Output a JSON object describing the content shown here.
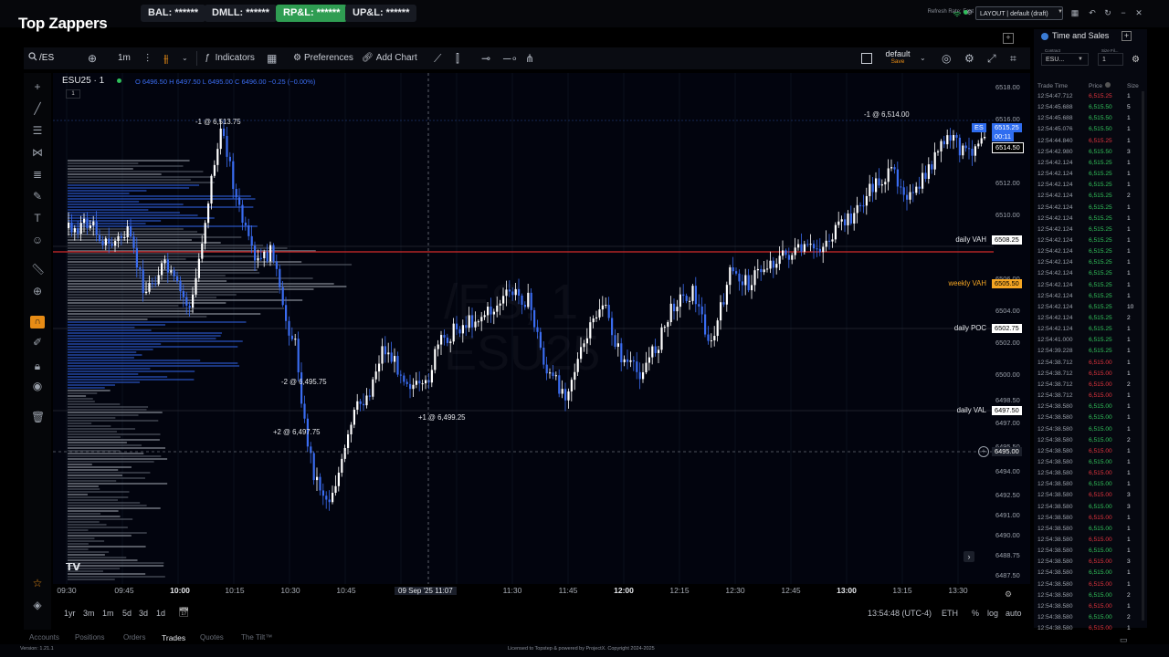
{
  "app": {
    "logo": "Top Zappers",
    "stats": [
      {
        "label": "BAL: ******",
        "style": "normal"
      },
      {
        "label": "DMLL: ******",
        "style": "normal"
      },
      {
        "label": "RP&L: ******",
        "style": "active"
      },
      {
        "label": "UP&L: ******",
        "style": "normal"
      }
    ],
    "refresh": "Refresh Rate: Fast",
    "layout": "LAYOUT | default (draft)"
  },
  "toolbar": {
    "symbol": "/ES",
    "interval": "1m",
    "indicators": "Indicators",
    "preferences": "Preferences",
    "add_chart": "Add Chart",
    "template_name": "default",
    "template_sub": "Save"
  },
  "chart": {
    "title": "ESU25 · 1",
    "sub_count": "1",
    "ohlc": "O 6496.50  H 6497.50  L 6495.00  C 6496.00  −0.25 (−0.00%)",
    "watermark_line1": "/ES, 1",
    "watermark_line2": "ESU25",
    "colors": {
      "up": "#ffffff",
      "down": "#3a6cf0",
      "resistance": "#d42a2a",
      "volume_profile": "#9aa0aa"
    },
    "price_labels": [
      "6518.00",
      "6516.00",
      "6512.00",
      "6510.00",
      "6506.00",
      "6504.00",
      "6502.00",
      "6500.00",
      "6498.50",
      "6497.00",
      "6495.50",
      "6494.00",
      "6492.50",
      "6491.00",
      "6490.00",
      "6488.75",
      "6487.50"
    ],
    "levels": [
      {
        "name": "daily VAH",
        "price": "6508.25",
        "color": "#ffffff",
        "bg": "#ffffff",
        "text": "#000000"
      },
      {
        "name": "weekly VAH",
        "price": "6505.50",
        "color": "#f5a623",
        "bg": "#f5a623",
        "text": "#000000"
      },
      {
        "name": "daily POC",
        "price": "6502.75",
        "color": "#ffffff",
        "bg": "#ffffff",
        "text": "#000000"
      },
      {
        "name": "daily VAL",
        "price": "6497.50",
        "color": "#ffffff",
        "bg": "#ffffff",
        "text": "#000000"
      }
    ],
    "current_price_label": "6514.50",
    "es_badge": "ES",
    "es_price": "6515.25",
    "es_time": "00:11",
    "crosshair_price": "6495.00",
    "trades": [
      "-1 @ 6,513.75",
      "-1 @ 6,514.00",
      "-2 @ 6,495.75",
      "+2 @ 6,497.75",
      "+1 @ 6,499.25"
    ],
    "time_labels": [
      "09:30",
      "09:45",
      "10:00",
      "10:15",
      "10:30",
      "10:45",
      "11:30",
      "11:45",
      "12:00",
      "12:15",
      "12:30",
      "12:45",
      "13:00",
      "13:15",
      "13:30"
    ],
    "crosshair_time": "09 Sep '25  11:07",
    "ranges": [
      "1yr",
      "3m",
      "1m",
      "5d",
      "3d",
      "1d"
    ],
    "clock": "13:54:48 (UTC-4)",
    "session": "ETH",
    "scale_opts": [
      "%",
      "log",
      "auto"
    ]
  },
  "tabs": [
    "Accounts",
    "Positions",
    "Orders",
    "Trades",
    "Quotes",
    "The Tilt™"
  ],
  "active_tab": "Trades",
  "footer": {
    "version": "Version: 1.21.1",
    "license": "Licensed to Topstep & powered by ProjectX. Copyright 2024-2025"
  },
  "time_and_sales": {
    "title": "Time and Sales",
    "contract_label": "Contract",
    "contract_value": "ESU...",
    "size_filter_label": "Size Fil...",
    "size_filter_value": "1",
    "headers": [
      "Trade Time",
      "Price",
      "Size"
    ],
    "rows": [
      {
        "time": "12:54:47.712",
        "price": "6,515.25",
        "size": "1",
        "side": "sell"
      },
      {
        "time": "12:54:45.688",
        "price": "6,515.50",
        "size": "5",
        "side": "buy"
      },
      {
        "time": "12:54:45.688",
        "price": "6,515.50",
        "size": "1",
        "side": "buy"
      },
      {
        "time": "12:54:45.076",
        "price": "6,515.50",
        "size": "1",
        "side": "buy"
      },
      {
        "time": "12:54:44.840",
        "price": "6,515.25",
        "size": "1",
        "side": "sell"
      },
      {
        "time": "12:54:42.980",
        "price": "6,515.50",
        "size": "3",
        "side": "buy"
      },
      {
        "time": "12:54:42.124",
        "price": "6,515.25",
        "size": "1",
        "side": "buy"
      },
      {
        "time": "12:54:42.124",
        "price": "6,515.25",
        "size": "1",
        "side": "buy"
      },
      {
        "time": "12:54:42.124",
        "price": "6,515.25",
        "size": "1",
        "side": "buy"
      },
      {
        "time": "12:54:42.124",
        "price": "6,515.25",
        "size": "2",
        "side": "buy"
      },
      {
        "time": "12:54:42.124",
        "price": "6,515.25",
        "size": "1",
        "side": "buy"
      },
      {
        "time": "12:54:42.124",
        "price": "6,515.25",
        "size": "1",
        "side": "buy"
      },
      {
        "time": "12:54:42.124",
        "price": "6,515.25",
        "size": "1",
        "side": "buy"
      },
      {
        "time": "12:54:42.124",
        "price": "6,515.25",
        "size": "1",
        "side": "buy"
      },
      {
        "time": "12:54:42.124",
        "price": "6,515.25",
        "size": "1",
        "side": "buy"
      },
      {
        "time": "12:54:42.124",
        "price": "6,515.25",
        "size": "1",
        "side": "buy"
      },
      {
        "time": "12:54:42.124",
        "price": "6,515.25",
        "size": "1",
        "side": "buy"
      },
      {
        "time": "12:54:42.124",
        "price": "6,515.25",
        "size": "1",
        "side": "buy"
      },
      {
        "time": "12:54:42.124",
        "price": "6,515.25",
        "size": "1",
        "side": "buy"
      },
      {
        "time": "12:54:42.124",
        "price": "6,515.25",
        "size": "10",
        "side": "buy"
      },
      {
        "time": "12:54:42.124",
        "price": "6,515.25",
        "size": "2",
        "side": "buy"
      },
      {
        "time": "12:54:42.124",
        "price": "6,515.25",
        "size": "1",
        "side": "buy"
      },
      {
        "time": "12:54:41.000",
        "price": "6,515.25",
        "size": "1",
        "side": "buy"
      },
      {
        "time": "12:54:39.228",
        "price": "6,515.25",
        "size": "1",
        "side": "buy"
      },
      {
        "time": "12:54:38.712",
        "price": "6,515.00",
        "size": "1",
        "side": "sell"
      },
      {
        "time": "12:54:38.712",
        "price": "6,515.00",
        "size": "1",
        "side": "sell"
      },
      {
        "time": "12:54:38.712",
        "price": "6,515.00",
        "size": "2",
        "side": "sell"
      },
      {
        "time": "12:54:38.712",
        "price": "6,515.00",
        "size": "1",
        "side": "sell"
      },
      {
        "time": "12:54:38.580",
        "price": "6,515.00",
        "size": "1",
        "side": "buy"
      },
      {
        "time": "12:54:38.580",
        "price": "6,515.00",
        "size": "1",
        "side": "buy"
      },
      {
        "time": "12:54:38.580",
        "price": "6,515.00",
        "size": "1",
        "side": "buy"
      },
      {
        "time": "12:54:38.580",
        "price": "6,515.00",
        "size": "2",
        "side": "buy"
      },
      {
        "time": "12:54:38.580",
        "price": "6,515.00",
        "size": "1",
        "side": "sell"
      },
      {
        "time": "12:54:38.580",
        "price": "6,515.00",
        "size": "1",
        "side": "buy"
      },
      {
        "time": "12:54:38.580",
        "price": "6,515.00",
        "size": "1",
        "side": "sell"
      },
      {
        "time": "12:54:38.580",
        "price": "6,515.00",
        "size": "1",
        "side": "buy"
      },
      {
        "time": "12:54:38.580",
        "price": "6,515.00",
        "size": "3",
        "side": "sell"
      },
      {
        "time": "12:54:38.580",
        "price": "6,515.00",
        "size": "3",
        "side": "buy"
      },
      {
        "time": "12:54:38.580",
        "price": "6,515.00",
        "size": "1",
        "side": "sell"
      },
      {
        "time": "12:54:38.580",
        "price": "6,515.00",
        "size": "1",
        "side": "buy"
      },
      {
        "time": "12:54:38.580",
        "price": "6,515.00",
        "size": "1",
        "side": "sell"
      },
      {
        "time": "12:54:38.580",
        "price": "6,515.00",
        "size": "1",
        "side": "buy"
      },
      {
        "time": "12:54:38.580",
        "price": "6,515.00",
        "size": "3",
        "side": "sell"
      },
      {
        "time": "12:54:38.580",
        "price": "6,515.00",
        "size": "1",
        "side": "buy"
      },
      {
        "time": "12:54:38.580",
        "price": "6,515.00",
        "size": "1",
        "side": "sell"
      },
      {
        "time": "12:54:38.580",
        "price": "6,515.00",
        "size": "2",
        "side": "buy"
      },
      {
        "time": "12:54:38.580",
        "price": "6,515.00",
        "size": "1",
        "side": "sell"
      },
      {
        "time": "12:54:38.580",
        "price": "6,515.00",
        "size": "2",
        "side": "buy"
      },
      {
        "time": "12:54:38.580",
        "price": "6,515.00",
        "size": "1",
        "side": "sell"
      }
    ]
  }
}
